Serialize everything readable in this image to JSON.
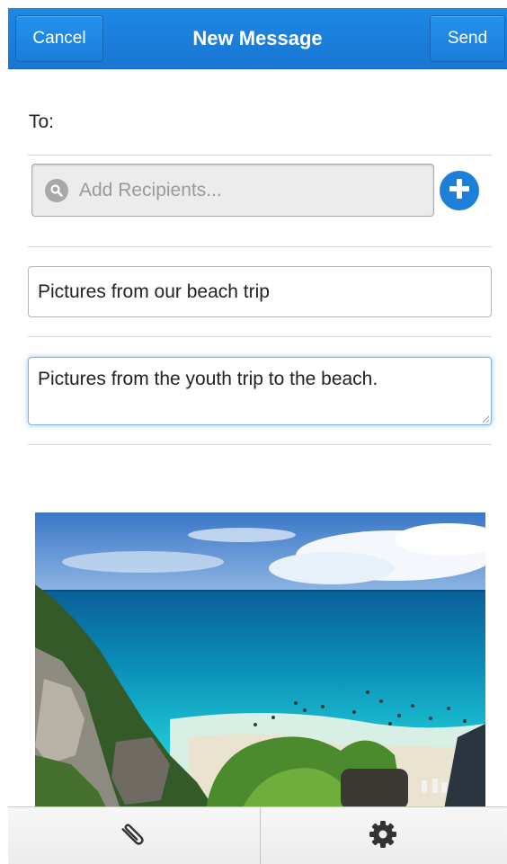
{
  "header": {
    "title": "New Message",
    "cancel_label": "Cancel",
    "send_label": "Send"
  },
  "form": {
    "to_label": "To:",
    "recipients_placeholder": "Add Recipients...",
    "subject_value": "Pictures from our beach trip",
    "body_value": "Pictures from the youth trip to the beach."
  },
  "colors": {
    "header_blue": "#1e88e5",
    "add_button_blue": "#1e7fd8"
  },
  "icons": {
    "search": "search-icon",
    "add": "plus-circle-icon",
    "attach": "paperclip-icon",
    "settings": "gear-icon"
  }
}
